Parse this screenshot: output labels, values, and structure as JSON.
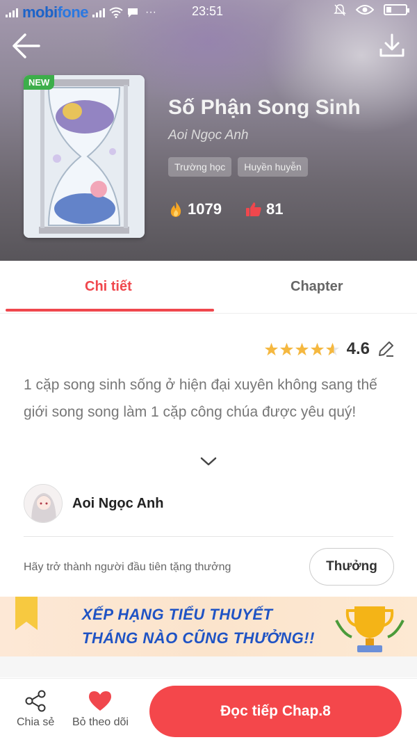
{
  "status_bar": {
    "carrier_part1": "mobi",
    "carrier_part2": "fone",
    "time": "23:51",
    "icons": [
      "signal-icon",
      "wifi-icon",
      "message-icon",
      "more-dots-icon",
      "mute-icon",
      "eye-icon",
      "battery-icon"
    ]
  },
  "header": {
    "badge": "NEW",
    "title": "Số Phận Song Sinh",
    "author": "Aoi Ngọc Anh",
    "tags": [
      "Trường học",
      "Huyền huyễn"
    ],
    "views": "1079",
    "likes": "81"
  },
  "tabs": {
    "active": "Chi tiết",
    "inactive": "Chapter"
  },
  "details": {
    "rating_value": "4.6",
    "rating_stars": 4.6,
    "description": "1 cặp song sinh sống ở hiện đại xuyên không sang thế giới song song làm 1 cặp công chúa được yêu quý!",
    "author_name": "Aoi Ngọc Anh",
    "reward_prompt": "Hãy trở thành người đầu tiên tặng thưởng",
    "reward_button": "Thưởng"
  },
  "banner": {
    "line1": "XẾP HẠNG TIỂU THUYẾT",
    "line2": "THÁNG NÀO CŨNG THƯỞNG!!"
  },
  "bottom_bar": {
    "share_label": "Chia sẻ",
    "follow_label": "Bỏ theo dõi",
    "read_button": "Đọc tiếp Chap.8"
  },
  "colors": {
    "accent": "#f0474d",
    "new_badge": "#3cae4a",
    "star": "#f5b840",
    "banner_text": "#1f53c4"
  }
}
